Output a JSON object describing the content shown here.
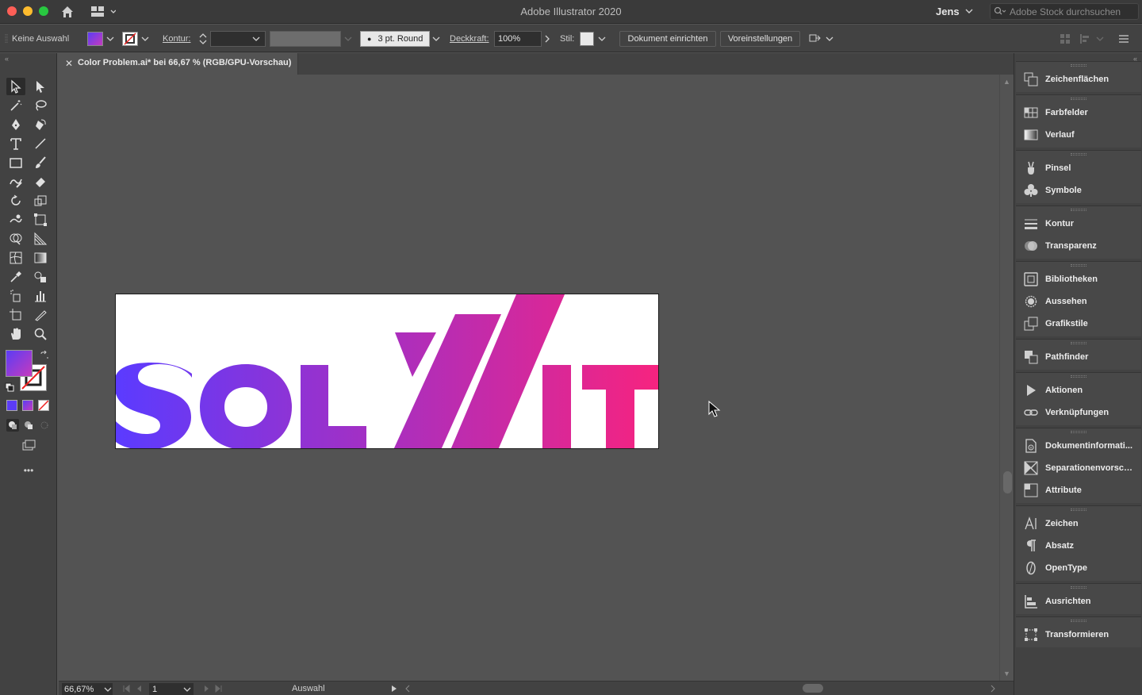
{
  "app": {
    "title": "Adobe Illustrator 2020",
    "user": "Jens",
    "stock_search_placeholder": "Adobe Stock durchsuchen"
  },
  "control_bar": {
    "selection_label": "Keine Auswahl",
    "stroke_label": "Kontur:",
    "brush_label": "3 pt. Round",
    "opacity_label": "Deckkraft:",
    "opacity_value": "100%",
    "style_label": "Stil:",
    "doc_setup_button": "Dokument einrichten",
    "preferences_button": "Voreinstellungen"
  },
  "document": {
    "tab_title": "Color Problem.ai* bei 66,67 % (RGB/GPU-Vorschau)",
    "artwork_text": "SOLVIT",
    "gradient_start": "#5b3bff",
    "gradient_end": "#f7237f"
  },
  "status_bar": {
    "zoom": "66,67%",
    "artboard_number": "1",
    "tool_mode": "Auswahl"
  },
  "toolbar": {
    "more_tools": "•••",
    "fill_color": "#5b3cf5",
    "fill_color_end": "#c63bbd"
  },
  "panels": [
    {
      "label": "Zeichenflächen",
      "icon": "artboards-icon"
    },
    {
      "label": "Farbfelder",
      "icon": "swatches-icon"
    },
    {
      "label": "Verlauf",
      "icon": "gradient-icon"
    },
    {
      "label": "Pinsel",
      "icon": "brushes-icon"
    },
    {
      "label": "Symbole",
      "icon": "symbols-icon"
    },
    {
      "label": "Kontur",
      "icon": "stroke-icon"
    },
    {
      "label": "Transparenz",
      "icon": "transparency-icon"
    },
    {
      "label": "Bibliotheken",
      "icon": "libraries-icon"
    },
    {
      "label": "Aussehen",
      "icon": "appearance-icon"
    },
    {
      "label": "Grafikstile",
      "icon": "graphic-styles-icon"
    },
    {
      "label": "Pathfinder",
      "icon": "pathfinder-icon"
    },
    {
      "label": "Aktionen",
      "icon": "actions-icon"
    },
    {
      "label": "Verknüpfungen",
      "icon": "links-icon"
    },
    {
      "label": "Dokumentinformati...",
      "icon": "document-info-icon"
    },
    {
      "label": "Separationenvorsch...",
      "icon": "separations-icon"
    },
    {
      "label": "Attribute",
      "icon": "attributes-icon"
    },
    {
      "label": "Zeichen",
      "icon": "character-icon"
    },
    {
      "label": "Absatz",
      "icon": "paragraph-icon"
    },
    {
      "label": "OpenType",
      "icon": "opentype-icon"
    },
    {
      "label": "Ausrichten",
      "icon": "align-icon"
    },
    {
      "label": "Transformieren",
      "icon": "transform-icon"
    }
  ]
}
